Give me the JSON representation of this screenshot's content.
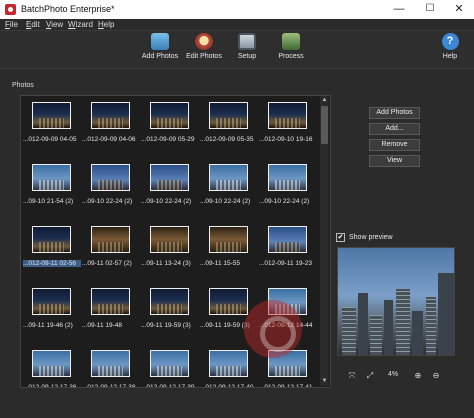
{
  "window": {
    "title": "BatchPhoto Enterprise*",
    "controls": {
      "minimize": "—",
      "maximize": "☐",
      "close": "✕"
    }
  },
  "menu": {
    "items": [
      {
        "underlined": "F",
        "rest": "ile"
      },
      {
        "underlined": "E",
        "rest": "dit"
      },
      {
        "underlined": "V",
        "rest": "iew"
      },
      {
        "underlined": "W",
        "rest": "izard"
      },
      {
        "underlined": "H",
        "rest": "elp"
      }
    ]
  },
  "toolbar": {
    "add_photos": "Add Photos",
    "edit_photos": "Edit Photos",
    "setup": "Setup",
    "process": "Process",
    "help": "Help",
    "help_glyph": "?",
    "icons": [
      "add-photos-icon",
      "edit-photos-icon",
      "setup-icon",
      "process-icon",
      "help-icon"
    ]
  },
  "photos": {
    "section_label": "Photos",
    "thumbnails": [
      {
        "label": "...012-09-09 04-05",
        "tone": "night"
      },
      {
        "label": "...012-09-09 04-06",
        "tone": "night"
      },
      {
        "label": "...012-09-09 05-29",
        "tone": "night"
      },
      {
        "label": "...012-09-09 05-35",
        "tone": "night"
      },
      {
        "label": "...012-09-10 19-16",
        "tone": "night"
      },
      {
        "label": "...09-10 21-54 (2)",
        "tone": "day"
      },
      {
        "label": "...09-10 22-24 (2)",
        "tone": "dusk"
      },
      {
        "label": "...09-10 22-24 (2)",
        "tone": "dusk"
      },
      {
        "label": "...09-10 22-24 (2)",
        "tone": "day"
      },
      {
        "label": "...09-10 22-24 (2)",
        "tone": "day"
      },
      {
        "label": "...012-09-11 02-56",
        "tone": "night",
        "selected": true
      },
      {
        "label": "...09-11 02-57 (2)",
        "tone": "warm"
      },
      {
        "label": "...09-11 13-24 (3)",
        "tone": "warm"
      },
      {
        "label": "...09-11 15-55",
        "tone": "warm"
      },
      {
        "label": "...012-09-11 19-23",
        "tone": "dusk"
      },
      {
        "label": "...09-11 19-46 (2)",
        "tone": "night"
      },
      {
        "label": "...09-11 19-48",
        "tone": "night"
      },
      {
        "label": "...09-11 19-59 (3)",
        "tone": "night"
      },
      {
        "label": "...09-11 19-59 (3)",
        "tone": "night"
      },
      {
        "label": "...012-09-12 14-44",
        "tone": "day"
      },
      {
        "label": "...012-09-12 17-36",
        "tone": "day"
      },
      {
        "label": "...012-09-12 17-38",
        "tone": "day"
      },
      {
        "label": "...012-09-12 17-39",
        "tone": "day"
      },
      {
        "label": "...012-09-12 17-40",
        "tone": "day"
      },
      {
        "label": "...012-09-12 17-41",
        "tone": "day"
      }
    ]
  },
  "actions": {
    "add_photos": "Add Photos",
    "add": "Add...",
    "remove": "Remove",
    "view": "View"
  },
  "preview": {
    "show_preview_label": "Show preview",
    "checked": true,
    "check_glyph": "✔",
    "zoom_level": "4%",
    "controls": [
      {
        "name": "fit-icon",
        "glyph": "⤧"
      },
      {
        "name": "actual-size-icon",
        "glyph": "⤢"
      },
      {
        "name": "zoom-in-icon",
        "glyph": "⊕"
      },
      {
        "name": "zoom-out-icon",
        "glyph": "⊖"
      }
    ]
  },
  "scrollbar": {
    "up_glyph": "▲",
    "down_glyph": "▼"
  }
}
